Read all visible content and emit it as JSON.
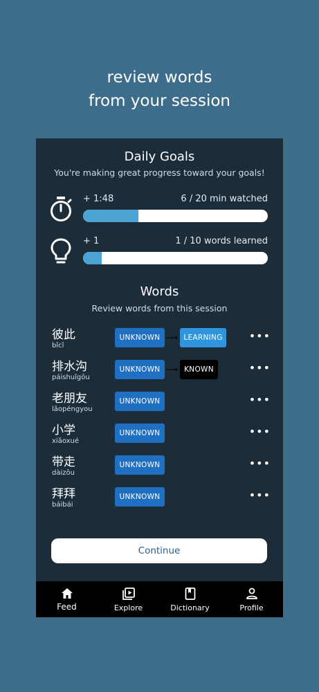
{
  "headline": {
    "line1": "review words",
    "line2": "from your session"
  },
  "goals": {
    "title": "Daily Goals",
    "subtitle": "You're making great progress toward your goals!",
    "items": [
      {
        "icon": "stopwatch-icon",
        "delta": "+ 1:48",
        "status": "6 / 20 min watched",
        "progress": 0.3
      },
      {
        "icon": "lightbulb-icon",
        "delta": "+ 1",
        "status": "1 / 10 words learned",
        "progress": 0.1
      }
    ]
  },
  "words": {
    "title": "Words",
    "subtitle": "Review words from this session",
    "items": [
      {
        "hanzi": "彼此",
        "pinyin": "bǐcǐ",
        "from": "UNKNOWN",
        "to": "LEARNING"
      },
      {
        "hanzi": "排水沟",
        "pinyin": "páishuǐgōu",
        "from": "UNKNOWN",
        "to": "KNOWN"
      },
      {
        "hanzi": "老朋友",
        "pinyin": "lǎopéngyou",
        "from": "UNKNOWN",
        "to": ""
      },
      {
        "hanzi": "小学",
        "pinyin": "xiǎoxué",
        "from": "UNKNOWN",
        "to": ""
      },
      {
        "hanzi": "带走",
        "pinyin": "dàizǒu",
        "from": "UNKNOWN",
        "to": ""
      },
      {
        "hanzi": "拜拜",
        "pinyin": "báibái",
        "from": "UNKNOWN",
        "to": ""
      }
    ],
    "more_label": "•••",
    "arrow": "⟶"
  },
  "continue_label": "Continue",
  "tabs": [
    {
      "label": "Feed",
      "icon": "home-icon",
      "active": true
    },
    {
      "label": "Explore",
      "icon": "video-library-icon",
      "active": false
    },
    {
      "label": "Dictionary",
      "icon": "book-icon",
      "active": false
    },
    {
      "label": "Profile",
      "icon": "person-icon",
      "active": false
    }
  ],
  "colors": {
    "background": "#3e6d8c",
    "panel": "#1c2c39",
    "unknown": "#1f6fc2",
    "learning": "#2f95dc",
    "known": "#000000",
    "progress": "#4aa3d3"
  }
}
